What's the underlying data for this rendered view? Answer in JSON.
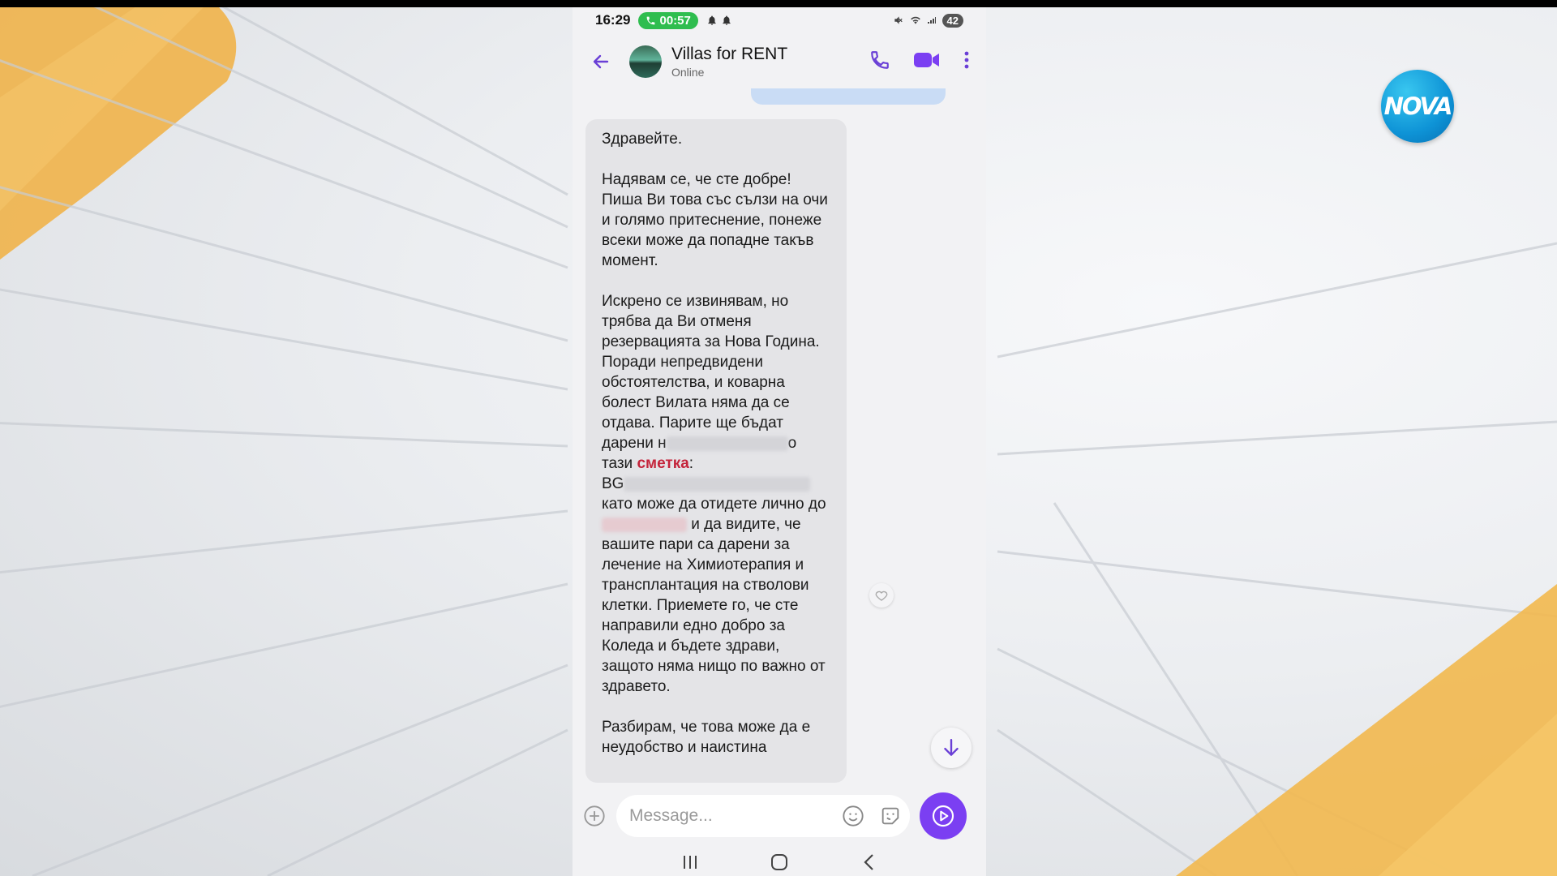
{
  "status_bar": {
    "time": "16:29",
    "call_duration": "00:57",
    "battery": "42"
  },
  "chat_header": {
    "contact_name": "Villas for RENT",
    "contact_status": "Online"
  },
  "message": {
    "greeting": "Здравейте.",
    "paragraph_2": "Надявам се, че сте добре! Пиша Ви това със сълзи на очи и голямо притеснение, понеже всеки може да попадне такъв момент.",
    "paragraph_3_a": "Искрено се извинявам, но трябва да Ви отменя резервацията за Нова Година. Поради непредвидени обстоятелства, и коварна болест Вилата няма да се отдава. Парите ще бъдат дарени н",
    "paragraph_3_a_tail": "о",
    "paragraph_3_b_prefix": "тази",
    "paragraph_3_b_link": "сметка",
    "paragraph_3_b_colon": ":",
    "iban_prefix": "BG",
    "paragraph_3_c": "като може да отидете лично до",
    "paragraph_3_d": "и да видите, че вашите пари са дарени за лечение на Химиотерапия и трансплантация на стволови клетки. Приемете го, че сте направили едно добро за Коледа и бъдете здрави, защото няма нищо по важно от здравето.",
    "paragraph_4": "Разбирам, че това може да е неудобство и наистина"
  },
  "composer": {
    "placeholder": "Message..."
  },
  "channel_logo": "NOVA",
  "icons": {
    "back": "back-arrow-icon",
    "voice_call": "phone-icon",
    "video_call": "video-camera-icon",
    "more": "more-vert-icon",
    "add": "plus-circle-icon",
    "emoji": "emoji-icon",
    "sticker": "sticker-icon",
    "send": "send-icon",
    "scroll_down": "arrow-down-icon",
    "reaction": "heart-icon"
  },
  "colors": {
    "accent": "#7b3ff2",
    "call_pill": "#2fbd4f",
    "link": "#c4243b",
    "logo": "#0e93d6"
  }
}
